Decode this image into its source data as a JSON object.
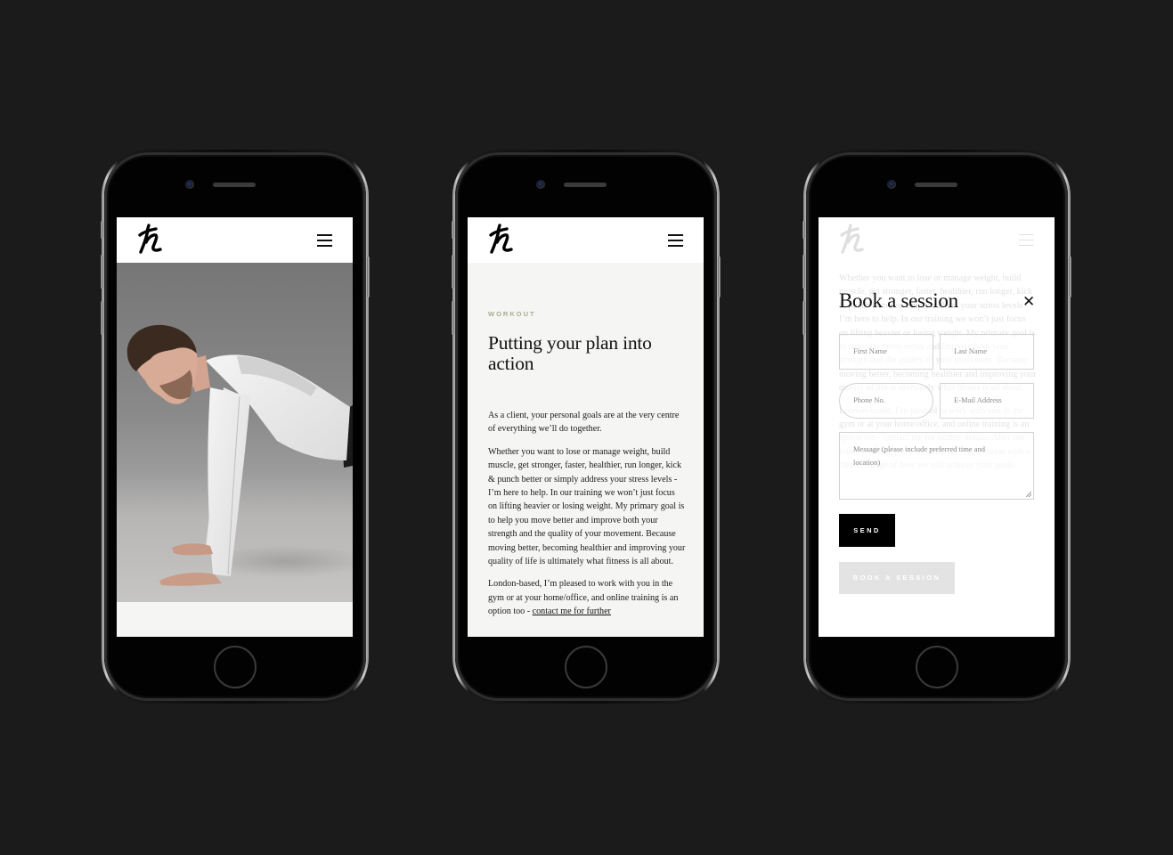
{
  "background_color": "#1b1b1b",
  "phones": [
    {
      "id": "hero",
      "header": {
        "logo_icon": "handwritten-h-logo",
        "menu_icon": "hamburger-menu-icon"
      },
      "hero_image": {
        "alt": "Man in white long-sleeve compression top holding a push-up plank position"
      }
    },
    {
      "id": "article",
      "header": {
        "logo_icon": "handwritten-h-logo",
        "menu_icon": "hamburger-menu-icon"
      },
      "eyebrow": "WORKOUT",
      "title": "Putting your plan into action",
      "paragraphs": [
        "As a client, your personal goals are at the very centre of everything we’ll do together.",
        "Whether you want to lose or manage weight, build muscle, get stronger, faster, healthier, run longer, kick & punch better or simply address your stress levels - I’m here to help. In our training we won’t just focus on lifting heavier or losing weight. My primary goal is to help you move better and improve both your strength and the quality of your movement. Because moving better, becoming healthier and improving your quality of life is ultimately what fitness is all about.",
        "London-based, I’m pleased to work with you in the gym or at your home/office, and online training is an option too - "
      ],
      "contact_link": "contact me for further",
      "accent_color": "#a9ad8e"
    },
    {
      "id": "booking-modal",
      "header": {
        "logo_icon": "handwritten-h-logo",
        "menu_icon": "hamburger-menu-icon"
      },
      "background_paragraphs": [
        "Whether you want to lose or manage weight, build muscle, get stronger, faster, healthier, run longer, kick & punch better or simply address your stress levels - I’m here to help. In our training we won’t just focus on lifting heavier or losing weight. My primary goal is to help you move better and improve both your strength and the quality of your movement. Because moving better, becoming healthier and improving your quality of life is ultimately what fitness is all about.",
        "London-based, I’m pleased to work with you in the gym or at your home/office, and online training is an option too - contact me for further details. After our initial meeting you will finish the consultation with a clearer image of how we will achieve your goals."
      ],
      "background_button": "BOOK A SESSION",
      "modal": {
        "title": "Book a session",
        "close_icon": "close-icon",
        "fields": {
          "first_name": {
            "placeholder": "First Name",
            "value": ""
          },
          "last_name": {
            "placeholder": "Last Name",
            "value": ""
          },
          "phone": {
            "placeholder": "Phone No.",
            "value": ""
          },
          "email": {
            "placeholder": "E-Mail Address",
            "value": ""
          },
          "message": {
            "placeholder": "Message (please include preferred time and location)",
            "value": ""
          }
        },
        "send_label": "SEND"
      }
    }
  ]
}
